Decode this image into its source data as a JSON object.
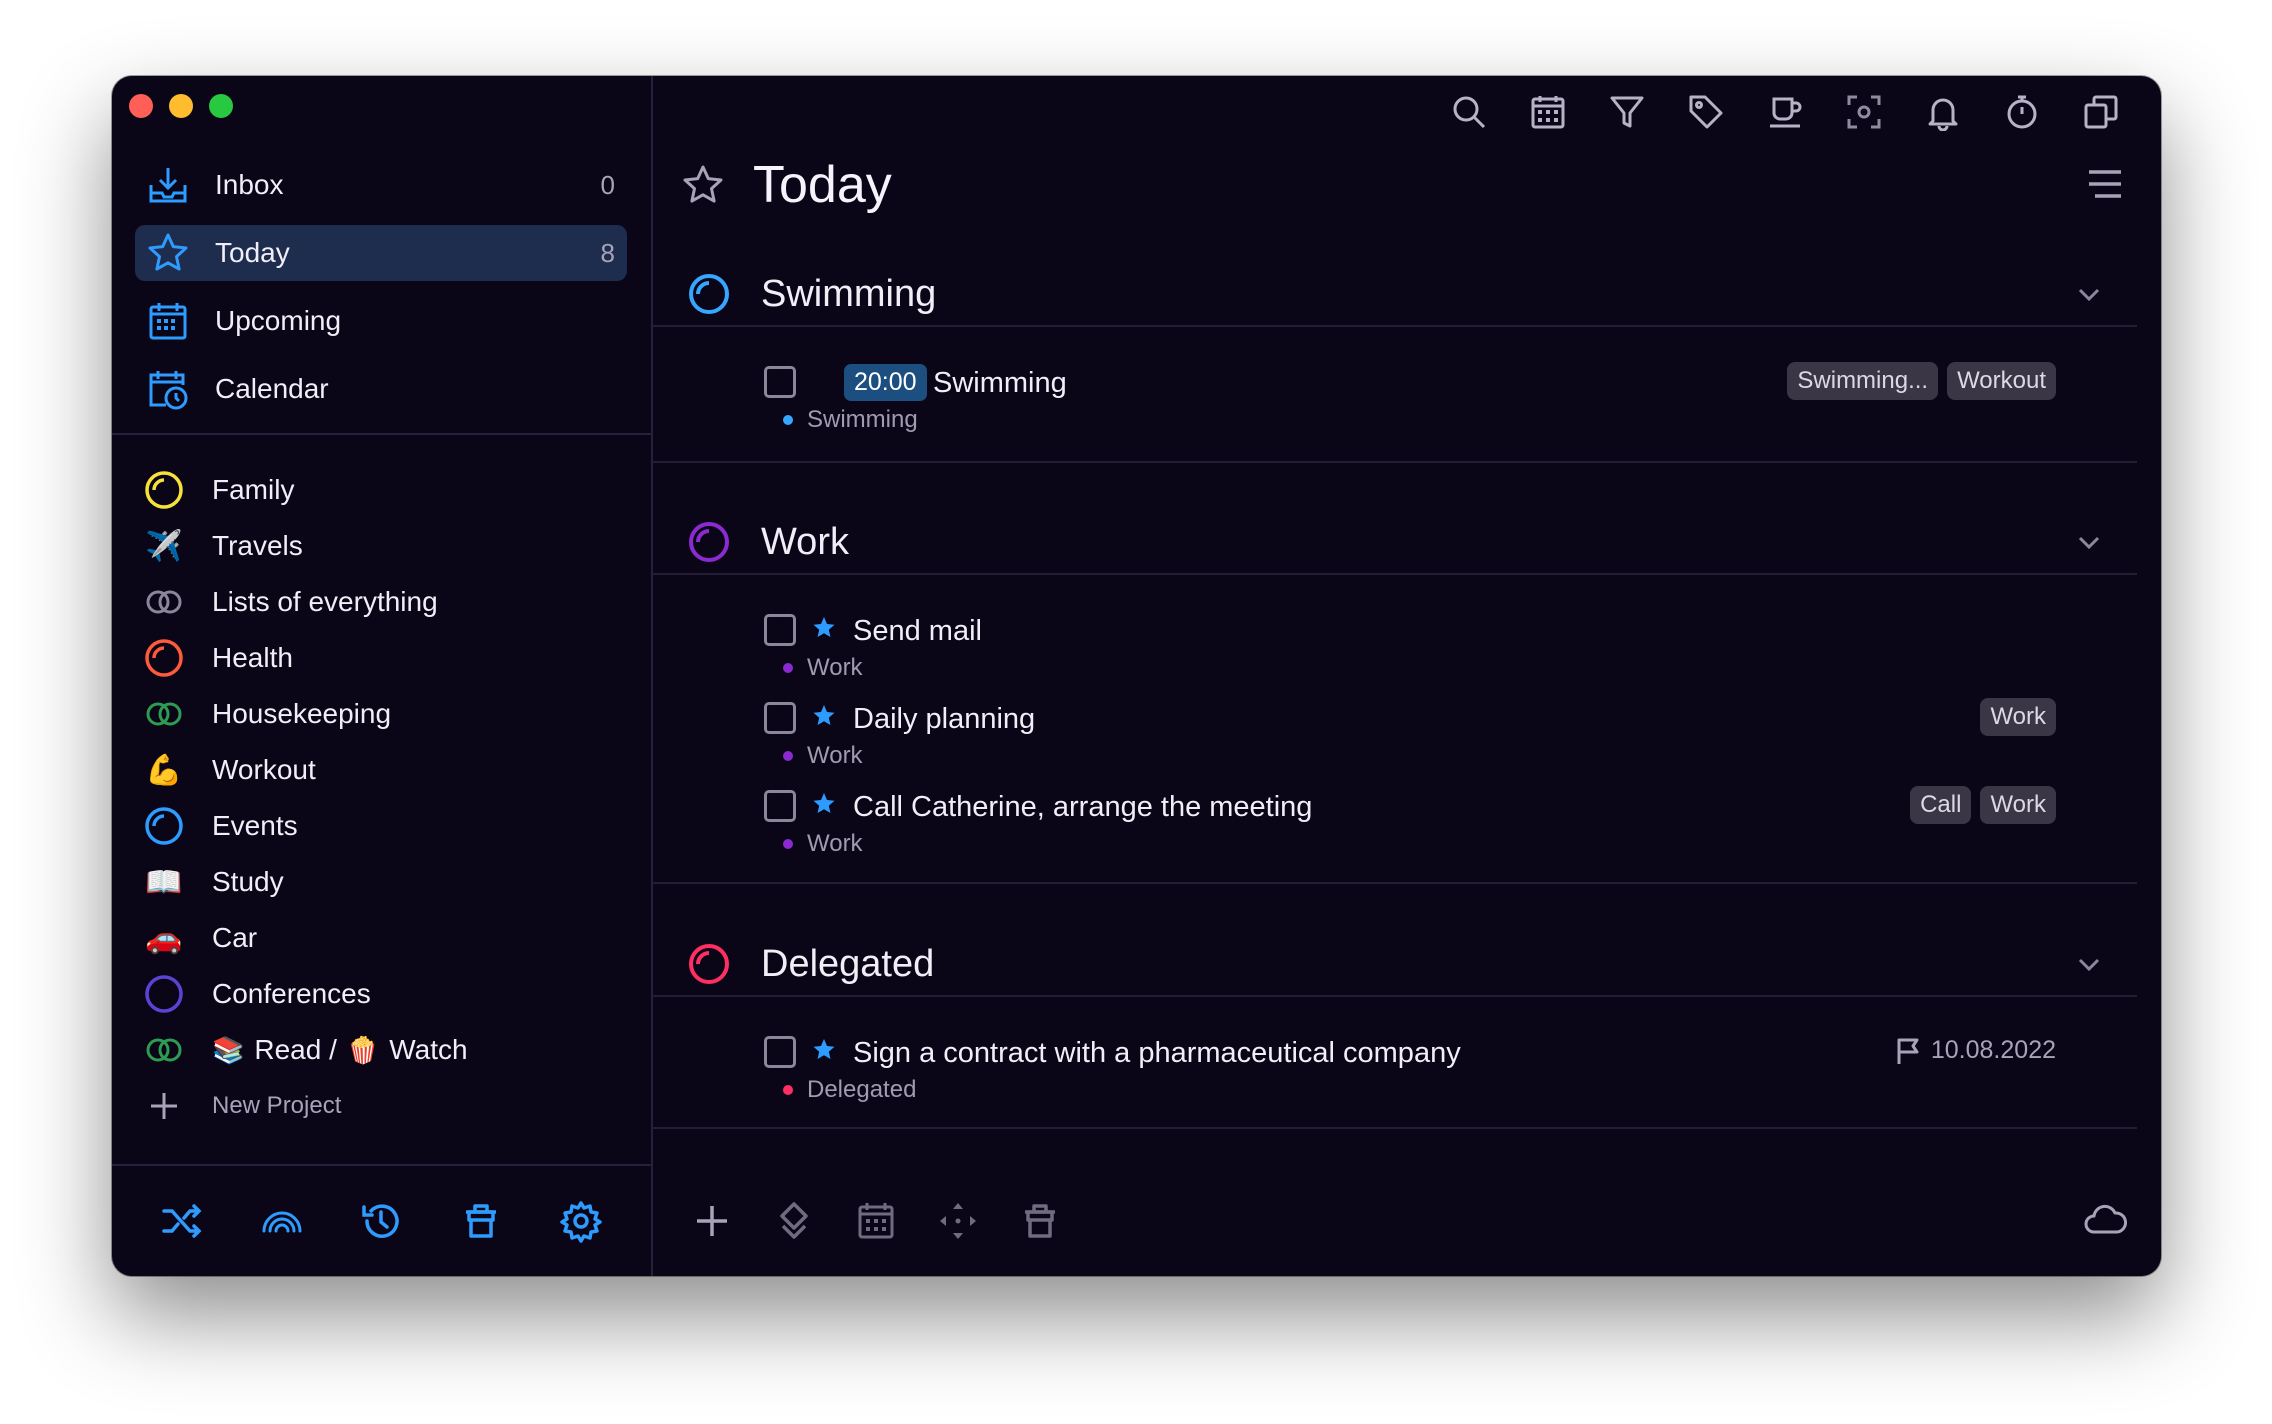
{
  "colors": {
    "accent": "#2e9bff",
    "window_bg": "#0b0617",
    "active_nav_bg": "#1e2d4d",
    "swimming": "#35a7ff",
    "work": "#8a2bd2",
    "delegated": "#ff2f63",
    "family": "#f7e23a",
    "health": "#ff5a3c",
    "housekeeping": "#2d9b52",
    "events": "#2e9bff",
    "conferences": "#5a44d6"
  },
  "sidebar": {
    "nav": [
      {
        "label": "Inbox",
        "count": "0",
        "icon": "inbox-icon"
      },
      {
        "label": "Today",
        "count": "8",
        "icon": "star-icon"
      },
      {
        "label": "Upcoming",
        "count": "",
        "icon": "calendar-grid-icon"
      },
      {
        "label": "Calendar",
        "count": "",
        "icon": "calendar-clock-icon"
      }
    ],
    "projects": [
      {
        "label": "Family",
        "icon": "yellow-ring-icon"
      },
      {
        "label": "Travels",
        "icon": "airplane-icon"
      },
      {
        "label": "Lists of everything",
        "icon": "double-ring-icon"
      },
      {
        "label": "Health",
        "icon": "red-ring-icon"
      },
      {
        "label": "Housekeeping",
        "icon": "green-double-ring-icon"
      },
      {
        "label": "Workout",
        "icon": "flexed-biceps-icon"
      },
      {
        "label": "Events",
        "icon": "blue-ring-icon"
      },
      {
        "label": "Study",
        "icon": "open-book-icon"
      },
      {
        "label": "Car",
        "icon": "car-icon"
      },
      {
        "label": "Conferences",
        "icon": "indigo-ring-icon"
      },
      {
        "label_a": "Read /",
        "label_b": "Watch",
        "icon": "green-double-ring-icon",
        "emoji_a": "books-icon",
        "emoji_b": "popcorn-icon"
      }
    ],
    "new_project_label": "New Project"
  },
  "main": {
    "title": "Today",
    "groups": [
      {
        "title": "Swimming",
        "color": "#35a7ff"
      },
      {
        "title": "Work",
        "color": "#8a2bd2"
      },
      {
        "title": "Delegated",
        "color": "#ff2f63"
      }
    ],
    "tasks": [
      {
        "time": "20:00",
        "name": "Swimming",
        "project": "Swimming",
        "tags": [
          "Swimming...",
          "Workout"
        ]
      },
      {
        "name": "Send mail",
        "project": "Work",
        "tags": []
      },
      {
        "name": "Daily planning",
        "project": "Work",
        "tags": [
          "Work"
        ]
      },
      {
        "name": "Call Catherine, arrange the meeting",
        "project": "Work",
        "tags": [
          "Call",
          "Work"
        ]
      },
      {
        "name": "Sign a contract with a pharmaceutical company",
        "project": "Delegated",
        "deadline": "10.08.2022"
      }
    ]
  }
}
